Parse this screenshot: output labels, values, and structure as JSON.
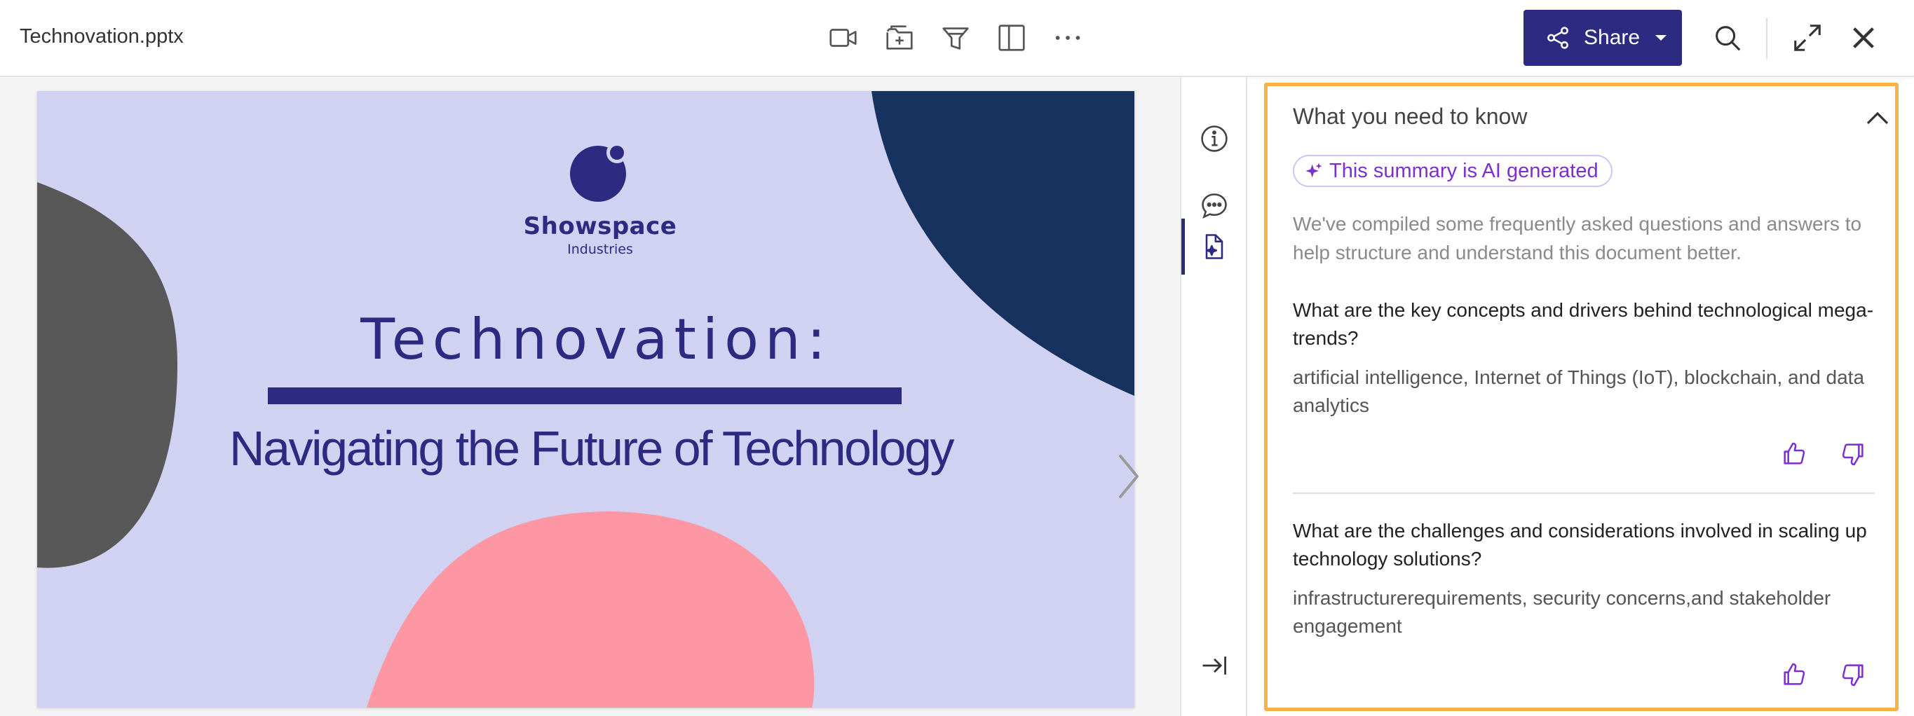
{
  "toolbar": {
    "filename": "Technovation.pptx",
    "share_label": "Share",
    "icons": [
      "video-icon",
      "add-to-folder-icon",
      "highlighter-icon",
      "panel-layout-icon",
      "more-icon"
    ],
    "right_icons": [
      "search-icon",
      "expand-icon",
      "close-icon"
    ],
    "accent_color": "#2d2a82"
  },
  "slide": {
    "logo_name": "Showspace",
    "logo_sub": "Industries",
    "title": "Technovation:",
    "subtitle": "Navigating the Future of Technology",
    "colors": {
      "background": "#d1d1f1",
      "primary": "#2d2a82",
      "navy_blob": "#17325f",
      "gray_blob": "#585858",
      "pink_blob": "#fe97a4"
    }
  },
  "rail": {
    "items": [
      "info-icon",
      "comments-icon",
      "ai-document-icon",
      "collapse-panel-icon"
    ],
    "active": "ai-document-icon"
  },
  "panel": {
    "title": "What you need to know",
    "ai_badge": "This summary is AI generated",
    "intro": "We've compiled some frequently asked questions and answers to help structure and understand this document better.",
    "qa": [
      {
        "question": "What are the key concepts and drivers behind technological mega-trends?",
        "answer": "artificial intelligence, Internet of Things (IoT), blockchain, and data analytics"
      },
      {
        "question": "What are the challenges and considerations involved in scaling up technology solutions?",
        "answer": "infrastructurerequirements, security concerns,and stakeholder engagement"
      }
    ],
    "border_color": "#f4b448",
    "ai_color": "#7b2fd1"
  }
}
